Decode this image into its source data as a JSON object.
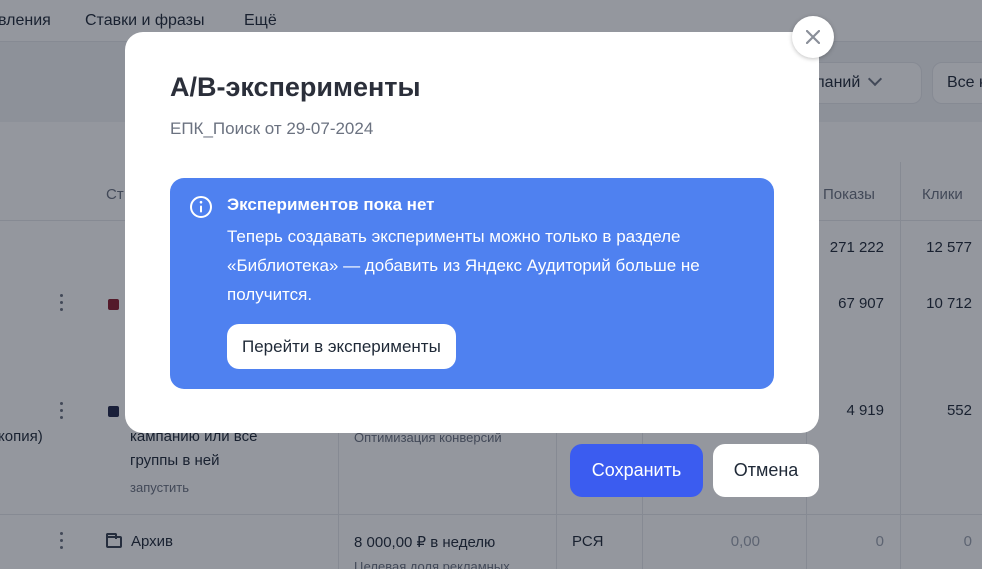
{
  "background": {
    "nav": [
      "вления",
      "Ставки и фразы",
      "Ещё"
    ],
    "filters": {
      "campaigns_select": "мпаний",
      "all_select": "Все к"
    },
    "table": {
      "headers": {
        "status": "Ст",
        "impressions": "Показы",
        "clicks": "Клики"
      },
      "totals": {
        "impressions": "271 222",
        "clicks": "12 577"
      },
      "row1": {
        "impressions": "67 907",
        "clicks": "10 712"
      },
      "row2": {
        "name_suffix": "копия)",
        "action_text_1": "кампанию или все",
        "action_text_2": "группы в ней",
        "action_link": "запустить",
        "strategy": "Оптимизация конверсий",
        "impressions": "4 919",
        "clicks": "552"
      },
      "row3": {
        "name": "Архив",
        "budget": "8 000,00 ₽ в неделю",
        "budget_note": "Целевая доля рекламных",
        "type": "РСЯ",
        "cost": "0,00",
        "impressions": "0",
        "clicks": "0"
      },
      "colors": {
        "row1_marker": "#8b1c2c",
        "row2_marker": "#1f2547"
      }
    }
  },
  "modal": {
    "title": "A/B-эксперименты",
    "subtitle": "ЕПК_Поиск от 29-07-2024",
    "info": {
      "title": "Экспериментов пока нет",
      "text": "Теперь создавать эксперименты можно только в разделе «Библиотека» — добавить из Яндекс Аудиторий больше не получится.",
      "button_label": "Перейти в эксперименты"
    },
    "save_label": "Сохранить",
    "cancel_label": "Отмена"
  },
  "colors": {
    "accent": "#3b5cf0",
    "info_bg": "#4f81f0"
  }
}
